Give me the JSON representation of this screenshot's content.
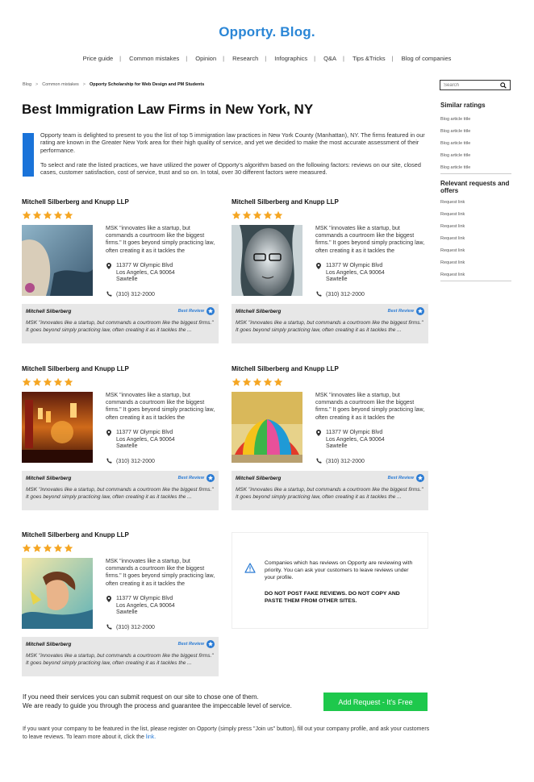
{
  "site": {
    "logo": "Opporty. Blog."
  },
  "nav": [
    "Price guide",
    "Common mistakes",
    "Opinion",
    "Research",
    "Infographics",
    "Q&A",
    "Tips &Tricks",
    "Blog of companies"
  ],
  "breadcrumb": {
    "items": [
      "Blog",
      "Common mistakes"
    ],
    "separator": ">",
    "current": "Opporty Scholarship for Web Design and PM Students"
  },
  "search": {
    "placeholder": "Search"
  },
  "page_title": "Best Immigration Law Firms in New York, NY",
  "intro": {
    "p1": "Opporty team is delighted to present to you the list of top 5 immigration law practices in New York County (Manhattan), NY. The firms featured in our rating are known in the Greater New York area for their high quality of service, and yet we decided to make the most accurate assessment of their performance.",
    "p2": "To select and rate the listed practices, we have utilized the power of Opporty's algorithm based on the following factors: reviews on our site, closed cases, customer satisfaction, cost of service, trust and so on. In total, over 30 different factors were measured."
  },
  "firms": [
    {
      "name": "Mitchell Silberberg and Knupp LLP",
      "rating": 5,
      "desc": "MSK \"innovates like a startup, but commands a courtroom like the biggest firms.\" It goes beyond simply practicing law, often creating it as it tackles the",
      "addr1": "11377 W Olympic Blvd",
      "addr2": "Los Angeles, CA 90064",
      "addr3": "Sawtelle",
      "phone": "(310) 312-2000",
      "reviewer": "Mitchell Silberberg",
      "badge": "Best Review",
      "review": "MSK \"innovates like a startup, but commands a courtroom like the biggest firms.\" It goes beyond simply practicing law, often creating it as it tackles the ..."
    },
    {
      "name": "Mitchell Silberberg and Knupp LLP",
      "rating": 5,
      "desc": "MSK \"innovates like a startup, but commands a courtroom like the biggest firms.\" It goes beyond simply practicing law, often creating it as it tackles the",
      "addr1": "11377 W Olympic Blvd",
      "addr2": "Los Angeles, CA 90064",
      "addr3": "Sawtelle",
      "phone": "(310) 312-2000",
      "reviewer": "Mitchell Silberberg",
      "badge": "Best Review",
      "review": "MSK \"innovates like a startup, but commands a courtroom like the biggest firms.\" It goes beyond simply practicing law, often creating it as it tackles the ..."
    },
    {
      "name": "Mitchell Silberberg and Knupp LLP",
      "rating": 5,
      "desc": "MSK \"innovates like a startup, but commands a courtroom like the biggest firms.\" It goes beyond simply practicing law, often creating it as it tackles the",
      "addr1": "11377 W Olympic Blvd",
      "addr2": "Los Angeles, CA 90064",
      "addr3": "Sawtelle",
      "phone": "(310) 312-2000",
      "reviewer": "Mitchell Silberberg",
      "badge": "Best Review",
      "review": "MSK \"innovates like a startup, but commands a courtroom like the biggest firms.\" It goes beyond simply practicing law, often creating it as it tackles the ..."
    },
    {
      "name": "Mitchell Silberberg and Knupp LLP",
      "rating": 5,
      "desc": "MSK \"innovates like a startup, but commands a courtroom like the biggest firms.\" It goes beyond simply practicing law, often creating it as it tackles the",
      "addr1": "11377 W Olympic Blvd",
      "addr2": "Los Angeles, CA 90064",
      "addr3": "Sawtelle",
      "phone": "(310) 312-2000",
      "reviewer": "Mitchell Silberberg",
      "badge": "Best Review",
      "review": "MSK \"innovates like a startup, but commands a courtroom like the biggest firms.\" It goes beyond simply practicing law, often creating it as it tackles the ..."
    },
    {
      "name": "Mitchell Silberberg and Knupp LLP",
      "rating": 5,
      "desc": "MSK \"innovates like a startup, but commands a courtroom like the biggest firms.\" It goes beyond simply practicing law, often creating it as it tackles the",
      "addr1": "11377 W Olympic Blvd",
      "addr2": "Los Angeles, CA 90064",
      "addr3": "Sawtelle",
      "phone": "(310) 312-2000",
      "reviewer": "Mitchell Silberberg",
      "badge": "Best Review",
      "review": "MSK \"innovates like a startup, but commands a courtroom like the biggest firms.\" It goes beyond simply practicing law, often creating it as it tackles the ..."
    }
  ],
  "notice": {
    "text": "Companies which has reviews on Opporty are reviewing with priority. You can ask your customers to leave reviews under your profile.",
    "warning": "DO NOT POST FAKE REVIEWS. DO NOT COPY AND PASTE THEM FROM OTHER SITES."
  },
  "sidebar": {
    "similar_title": "Similar ratings",
    "similar": [
      "Blog article title",
      "Blog article title",
      "Blog article title",
      "Blog article title",
      "Blog article title"
    ],
    "requests_title": "Relevant requests and offers",
    "requests": [
      "Request link",
      "Request link",
      "Request link",
      "Request link",
      "Request link",
      "Request link",
      "Request link"
    ]
  },
  "cta": {
    "line1": "If you need their services you can submit request on our site to chose one of them.",
    "line2": "We are ready to guide you through the process and guarantee the impeccable level of service.",
    "button": "Add Request - It's Free"
  },
  "footer": {
    "text": "If you want your company to be featured in the list, please register on Opporty (simply press \"Join us\" button), fill out your company profile, and ask your customers to leave reviews. To learn more about it, click the",
    "link": "link."
  },
  "colors": {
    "brand": "#2a86d6",
    "accent_bar": "#1a73d9",
    "star": "#f5a623",
    "cta": "#1ec84c",
    "review_bg": "#e7e7e7"
  },
  "icons": {
    "search": "search-icon",
    "location": "location-pin-icon",
    "phone": "phone-icon",
    "badge": "star-badge-icon",
    "warning": "warning-triangle-icon"
  }
}
